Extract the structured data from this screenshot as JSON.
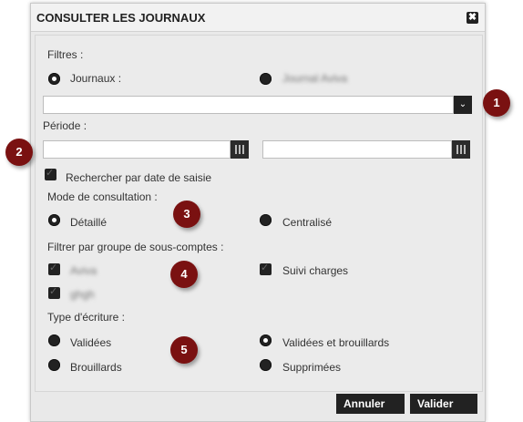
{
  "dialog": {
    "title": "CONSULTER LES JOURNAUX",
    "close": "✖"
  },
  "filters": {
    "heading": "Filtres :",
    "journaux_label": "Journaux :",
    "journal_aviva_label": "Journal Aviva",
    "select_arrow": "⌄"
  },
  "periode": {
    "heading": "Période :",
    "search_by_entry_date": "Rechercher par date de saisie"
  },
  "mode": {
    "heading": "Mode de consultation :",
    "detaille": "Détaillé",
    "centralise": "Centralisé"
  },
  "groupes": {
    "heading": "Filtrer par groupe de sous-comptes :",
    "item1": "Aviva",
    "item2": "ghgh",
    "suivi": "Suivi charges"
  },
  "type_ecriture": {
    "heading": "Type d'écriture :",
    "validees": "Validées",
    "validees_brouillards": "Validées et brouillards",
    "brouillards": "Brouillards",
    "supprimees": "Supprimées"
  },
  "badges": [
    "1",
    "2",
    "3",
    "4",
    "5"
  ],
  "footer": {
    "cancel": "Annuler",
    "validate": "Valider"
  }
}
